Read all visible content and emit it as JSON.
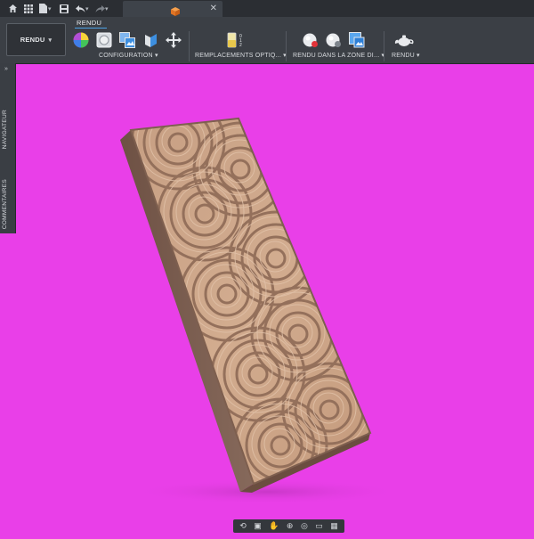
{
  "window": {
    "active_doc_icon": "orange-cube-icon",
    "close_glyph": "✕"
  },
  "quick_access": [
    {
      "name": "home-icon"
    },
    {
      "name": "grid-icon"
    },
    {
      "name": "file-icon"
    },
    {
      "name": "save-icon"
    },
    {
      "name": "undo-icon"
    },
    {
      "name": "redo-icon"
    }
  ],
  "toolbar": {
    "workspace_label": "RENDU",
    "workspace_caret": "▾",
    "ribbon_tab": "RENDU",
    "groups": [
      {
        "label": "CONFIGURATION ▾"
      },
      {
        "label": "REMPLACEMENTS OPTIQ... ▾"
      },
      {
        "label": "RENDU DANS LA ZONE DI... ▾"
      },
      {
        "label": "RENDU ▾"
      }
    ]
  },
  "left_panel": {
    "navigator_label": "NAVIGATEUR",
    "comments_label": "COMMENTAIRES"
  },
  "viewport": {
    "background_color": "#e93fe8",
    "model": "carved-wooden-tile-with-concentric-circle-pattern"
  },
  "nav_bar": [
    {
      "name": "orbit-icon",
      "glyph": "⟲"
    },
    {
      "name": "look-at-icon",
      "glyph": "▣"
    },
    {
      "name": "pan-icon",
      "glyph": "✋"
    },
    {
      "name": "zoom-icon",
      "glyph": "⊕"
    },
    {
      "name": "fit-icon",
      "glyph": "◎"
    },
    {
      "name": "display-settings-icon",
      "glyph": "▭"
    },
    {
      "name": "grid-settings-icon",
      "glyph": "▦"
    }
  ]
}
